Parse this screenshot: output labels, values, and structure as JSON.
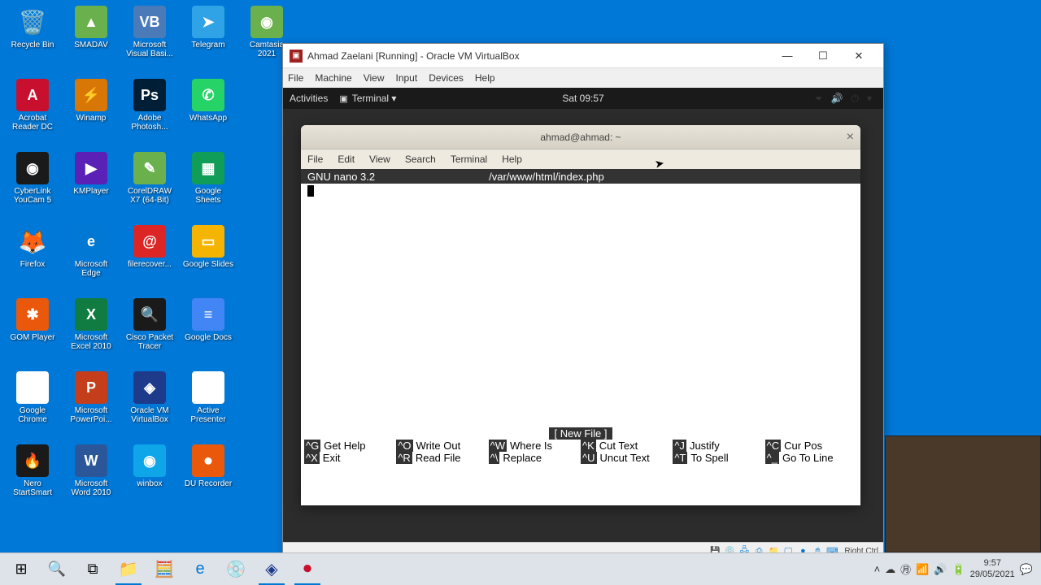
{
  "desktop_icons": [
    {
      "name": "recycle-bin",
      "label": "Recycle Bin",
      "glyph": "🗑️",
      "bg": ""
    },
    {
      "name": "smadav",
      "label": "SMADAV",
      "glyph": "▲",
      "bg": "#6ab04c"
    },
    {
      "name": "visual-basic",
      "label": "Microsoft Visual Basi...",
      "glyph": "VB",
      "bg": "#4a7bb8"
    },
    {
      "name": "telegram",
      "label": "Telegram",
      "glyph": "➤",
      "bg": "#30a3e6"
    },
    {
      "name": "camtasia",
      "label": "Camtasia 2021",
      "glyph": "◉",
      "bg": "#6ab04c"
    },
    {
      "name": "acrobat",
      "label": "Acrobat Reader DC",
      "glyph": "A",
      "bg": "#c8102e"
    },
    {
      "name": "winamp",
      "label": "Winamp",
      "glyph": "⚡",
      "bg": "#d97706"
    },
    {
      "name": "photoshop",
      "label": "Adobe Photosh...",
      "glyph": "Ps",
      "bg": "#001e36"
    },
    {
      "name": "whatsapp",
      "label": "WhatsApp",
      "glyph": "✆",
      "bg": "#25d366"
    },
    {
      "name": "empty1",
      "label": "",
      "glyph": "",
      "bg": ""
    },
    {
      "name": "youcam",
      "label": "CyberLink YouCam 5",
      "glyph": "◉",
      "bg": "#1a1a1a"
    },
    {
      "name": "kmplayer",
      "label": "KMPlayer",
      "glyph": "▶",
      "bg": "#5b21b6"
    },
    {
      "name": "coreldraw",
      "label": "CorelDRAW X7 (64-Bit)",
      "glyph": "✎",
      "bg": "#6ab04c"
    },
    {
      "name": "sheets",
      "label": "Google Sheets",
      "glyph": "▦",
      "bg": "#0f9d58"
    },
    {
      "name": "empty2",
      "label": "",
      "glyph": "",
      "bg": ""
    },
    {
      "name": "firefox",
      "label": "Firefox",
      "glyph": "🦊",
      "bg": ""
    },
    {
      "name": "edge",
      "label": "Microsoft Edge",
      "glyph": "e",
      "bg": "#0078d4"
    },
    {
      "name": "filerecovery",
      "label": "filerecover...",
      "glyph": "@",
      "bg": "#dc2626"
    },
    {
      "name": "slides",
      "label": "Google Slides",
      "glyph": "▭",
      "bg": "#f4b400"
    },
    {
      "name": "empty3",
      "label": "",
      "glyph": "",
      "bg": ""
    },
    {
      "name": "gom",
      "label": "GOM Player",
      "glyph": "✱",
      "bg": "#ea580c"
    },
    {
      "name": "excel",
      "label": "Microsoft Excel 2010",
      "glyph": "X",
      "bg": "#107c41"
    },
    {
      "name": "packet-tracer",
      "label": "Cisco Packet Tracer",
      "glyph": "🔍",
      "bg": "#1a1a1a"
    },
    {
      "name": "docs",
      "label": "Google Docs",
      "glyph": "≡",
      "bg": "#4285f4"
    },
    {
      "name": "empty4",
      "label": "",
      "glyph": "",
      "bg": ""
    },
    {
      "name": "chrome",
      "label": "Google Chrome",
      "glyph": "●",
      "bg": "#fff"
    },
    {
      "name": "powerpoint",
      "label": "Microsoft PowerPoi...",
      "glyph": "P",
      "bg": "#c43e1c"
    },
    {
      "name": "virtualbox",
      "label": "Oracle VM VirtualBox",
      "glyph": "◈",
      "bg": "#1e3a8a"
    },
    {
      "name": "activepresenter",
      "label": "Active Presenter",
      "glyph": "a",
      "bg": "#fff"
    },
    {
      "name": "empty5",
      "label": "",
      "glyph": "",
      "bg": ""
    },
    {
      "name": "nero",
      "label": "Nero StartSmart",
      "glyph": "🔥",
      "bg": "#1a1a1a"
    },
    {
      "name": "word",
      "label": "Microsoft Word 2010",
      "glyph": "W",
      "bg": "#2b579a"
    },
    {
      "name": "winbox",
      "label": "winbox",
      "glyph": "◉",
      "bg": "#0ea5e9"
    },
    {
      "name": "durecorder",
      "label": "DU Recorder",
      "glyph": "⏺",
      "bg": "#ea580c"
    },
    {
      "name": "empty6",
      "label": "",
      "glyph": "",
      "bg": ""
    }
  ],
  "vbox": {
    "title": "Ahmad Zaelani [Running] - Oracle VM VirtualBox",
    "menu": [
      "File",
      "Machine",
      "View",
      "Input",
      "Devices",
      "Help"
    ],
    "status_host_key": "Right Ctrl"
  },
  "gnome": {
    "activities": "Activities",
    "app": "Terminal ▾",
    "time": "Sat 09:57"
  },
  "terminal": {
    "title": "ahmad@ahmad: ~",
    "menu": [
      "File",
      "Edit",
      "View",
      "Search",
      "Terminal",
      "Help"
    ],
    "nano": {
      "version": "GNU nano 3.2",
      "file": "/var/www/html/index.php",
      "status": "[ New File ]",
      "commands": [
        {
          "k": "^G",
          "l": "Get Help"
        },
        {
          "k": "^O",
          "l": "Write Out"
        },
        {
          "k": "^W",
          "l": "Where Is"
        },
        {
          "k": "^K",
          "l": "Cut Text"
        },
        {
          "k": "^J",
          "l": "Justify"
        },
        {
          "k": "^C",
          "l": "Cur Pos"
        },
        {
          "k": "^X",
          "l": "Exit"
        },
        {
          "k": "^R",
          "l": "Read File"
        },
        {
          "k": "^\\",
          "l": "Replace"
        },
        {
          "k": "^U",
          "l": "Uncut Text"
        },
        {
          "k": "^T",
          "l": "To Spell"
        },
        {
          "k": "^_",
          "l": "Go To Line"
        }
      ]
    }
  },
  "taskbar": {
    "time": "9:57",
    "date": "29/05/2021"
  }
}
